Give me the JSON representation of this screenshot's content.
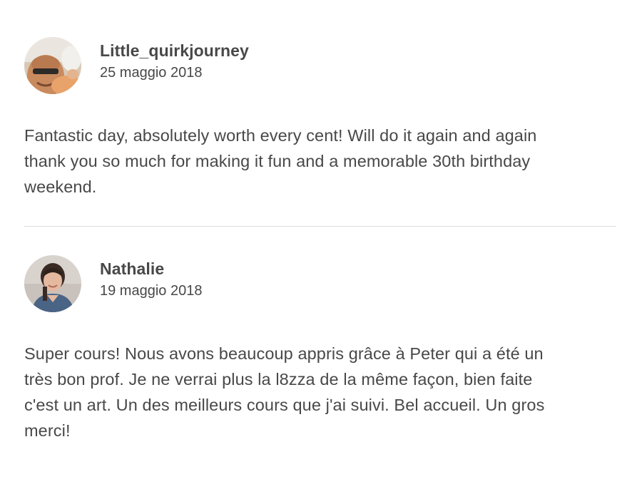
{
  "reviews": [
    {
      "author": "Little_quirkjourney",
      "date": "25 maggio 2018",
      "text": "Fantastic day, absolutely worth every cent! Will do it again and again\nthank you so much for making it fun and a memorable 30th birthday\nweekend."
    },
    {
      "author": "Nathalie",
      "date": "19 maggio 2018",
      "text": "Super cours! Nous avons beaucoup appris grâce à Peter qui a été un\ntrès bon prof. Je ne verrai plus la l8zza de la même façon, bien faite\nc'est un art. Un des meilleurs cours que j'ai suivi. Bel accueil. Un gros\nmerci!"
    }
  ],
  "colors": {
    "text": "#484848",
    "divider": "#dcdcdc",
    "background": "#ffffff"
  }
}
